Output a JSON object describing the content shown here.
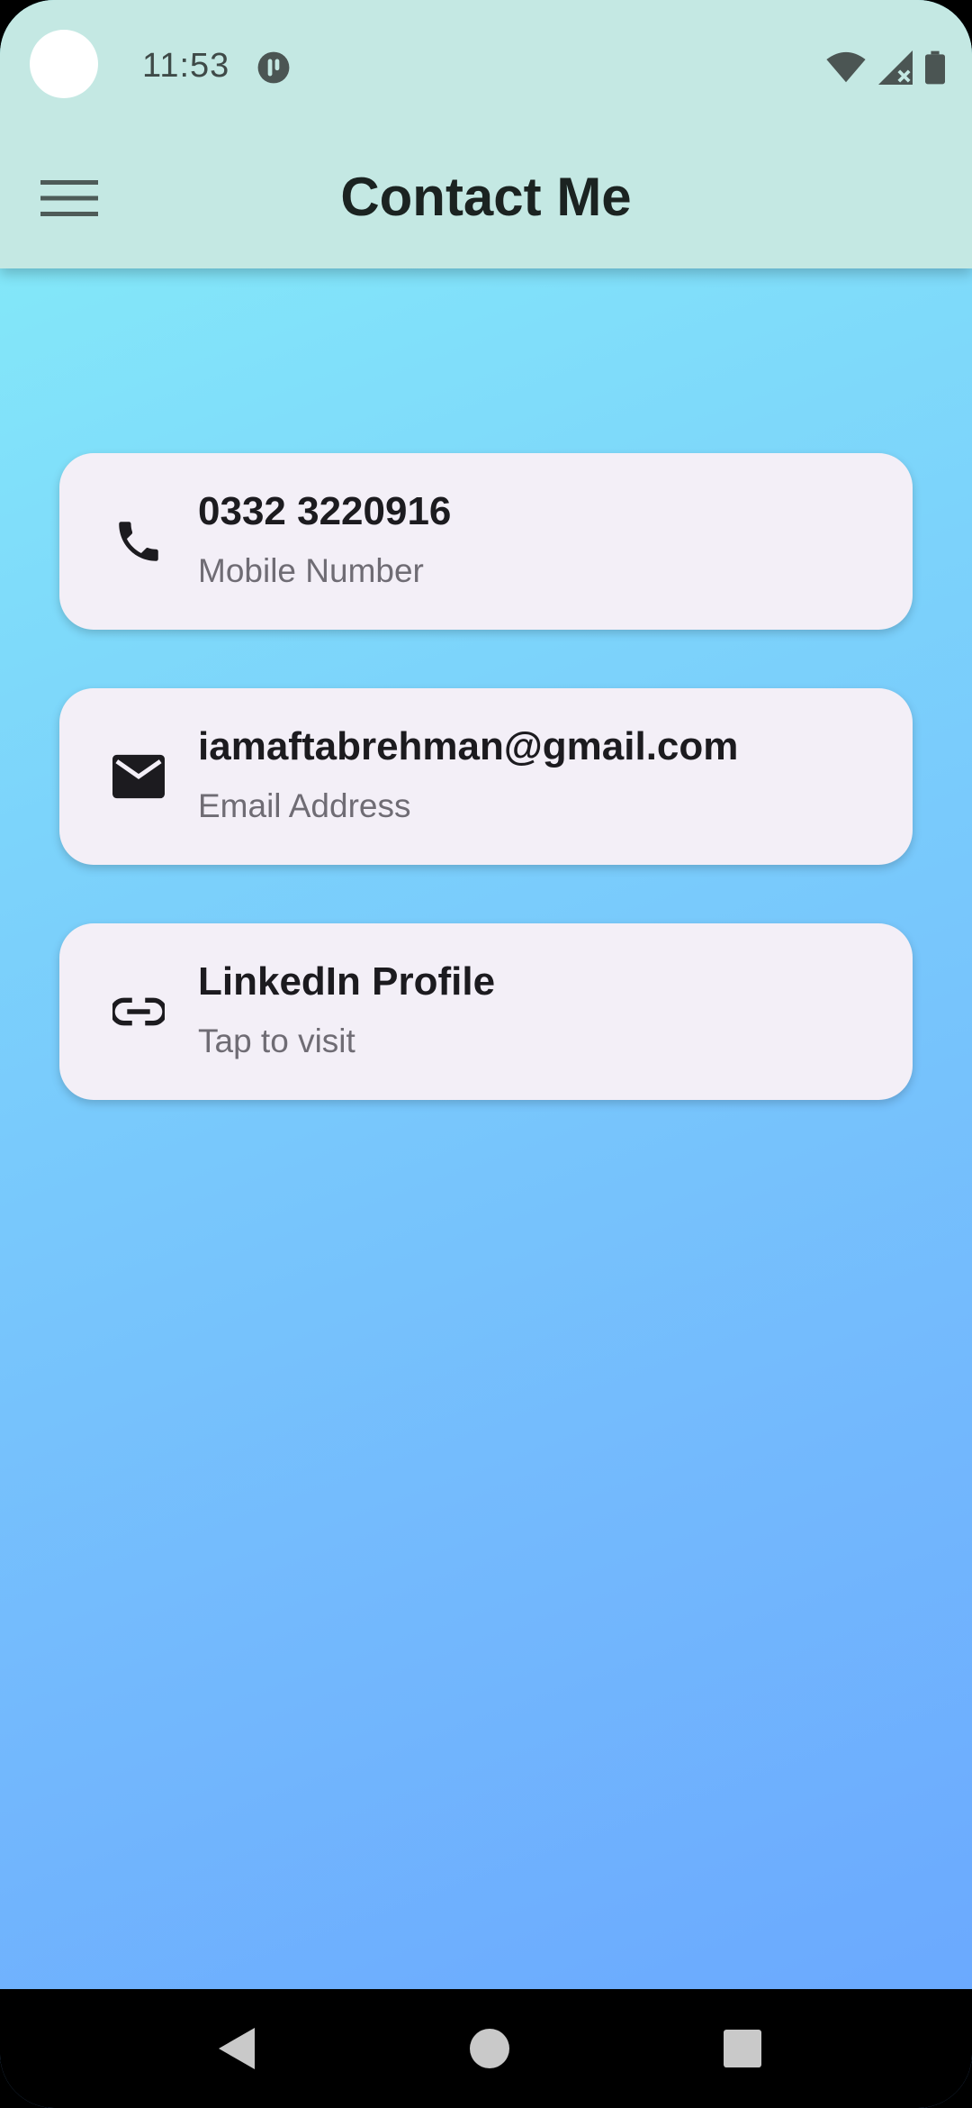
{
  "status_bar": {
    "time": "11:53",
    "icons": [
      "camera-cutout",
      "notification-app-icon",
      "wifi-icon",
      "signal-icon",
      "battery-icon"
    ]
  },
  "app_bar": {
    "title": "Contact Me",
    "menu_icon": "menu-icon",
    "background": "#c4e8e3"
  },
  "contacts": [
    {
      "icon": "phone-icon",
      "title": "0332 3220916",
      "subtitle": "Mobile Number"
    },
    {
      "icon": "email-icon",
      "title": "iamaftabrehman@gmail.com",
      "subtitle": "Email Address"
    },
    {
      "icon": "link-icon",
      "title": "LinkedIn Profile",
      "subtitle": "Tap to visit"
    }
  ],
  "nav_bar": {
    "buttons": [
      "back-icon",
      "home-icon",
      "recents-icon"
    ]
  },
  "colors": {
    "gradient_start": "#86f0f8",
    "gradient_end": "#69a6fe",
    "card_background": "#f3eff7",
    "title_text": "#1c1b1f",
    "subtitle_text": "#6f6c74"
  }
}
